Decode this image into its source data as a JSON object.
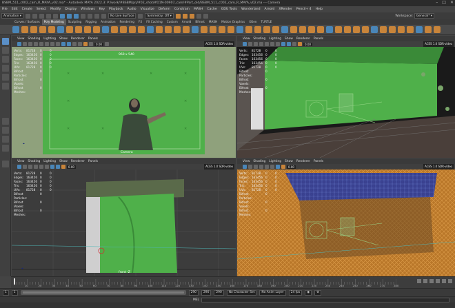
{
  "window": {
    "title": "BSBM_511_c002_cam_R_MAYA_v02.ma* - Autodesk MAYA 2022.3: P:/work/#BSBM/prj/#02_shot/#D1N-00907_cam/#Part_old/BSBM_511_c002_cam_R_MAYA_v02.ma --- Camera",
    "min_icon": "minimize-icon",
    "max_icon": "maximize-icon",
    "close_icon": "close-icon"
  },
  "menus": [
    "File",
    "Edit",
    "Create",
    "Select",
    "Modify",
    "Display",
    "Windows",
    "Key",
    "Playback",
    "Audio",
    "Visualize",
    "Deform",
    "Constrain",
    "MASH",
    "Cache",
    "GDU Tools",
    "Wonderland",
    "Arnold",
    "XRender",
    "Pencil+ 4",
    "Help"
  ],
  "status_line": {
    "mode": "Animation",
    "live_surface": "No Live Surface",
    "symmetry": "Symmetry: Off",
    "workspace_label": "Workspace:",
    "workspace_value": "General*"
  },
  "shelf_tabs": [
    "Curves / Surfaces",
    "Poly Modeling",
    "Sculpting",
    "Rigging",
    "Animation",
    "Rendering",
    "FX",
    "FX Caching",
    "Custom",
    "Arnold",
    "Bifrost",
    "MASH",
    "Motion Graphics",
    "XGen",
    "TURTLE"
  ],
  "active_shelf_tab": "Poly Modeling",
  "panel_menu": [
    "View",
    "Shading",
    "Lighting",
    "Show",
    "Renderer",
    "Panels"
  ],
  "viewports": [
    {
      "id": "top-left",
      "frame_value": "0.00",
      "color_space": "ACES 1.0 SDR-video",
      "top_readout": "960 x 540",
      "camera_label": "Camera",
      "hud": [
        {
          "label": "Verts:",
          "value": "81728",
          "c1": "0",
          "c2": "0"
        },
        {
          "label": "Edges:",
          "value": "163456",
          "c1": "0",
          "c2": "0"
        },
        {
          "label": "Faces:",
          "value": "163456",
          "c1": "0",
          "c2": "0"
        },
        {
          "label": "Tris:",
          "value": "163456",
          "c1": "0",
          "c2": "0"
        },
        {
          "label": "UVs:",
          "value": "81728",
          "c1": "0",
          "c2": "0"
        },
        {
          "label": "Bifrost Particles:",
          "value": "",
          "c1": "0",
          "c2": ""
        },
        {
          "label": "Bifrost Voxels:",
          "value": "",
          "c1": "0",
          "c2": ""
        },
        {
          "label": "Bifrost Meshes:",
          "value": "",
          "c1": "0",
          "c2": ""
        }
      ]
    },
    {
      "id": "top-right",
      "frame_value": "0.00",
      "color_space": "ACES 1.0 SDR-video",
      "hud": [
        {
          "label": "Verts:",
          "value": "81728",
          "c1": "0",
          "c2": "0"
        },
        {
          "label": "Edges:",
          "value": "163456",
          "c1": "0",
          "c2": "0"
        },
        {
          "label": "Faces:",
          "value": "163456",
          "c1": "0",
          "c2": "0"
        },
        {
          "label": "Tris:",
          "value": "163456",
          "c1": "0",
          "c2": "0"
        },
        {
          "label": "UVs:",
          "value": "81728",
          "c1": "0",
          "c2": "0"
        },
        {
          "label": "Bifrost Particles:",
          "value": "",
          "c1": "0",
          "c2": ""
        },
        {
          "label": "Bifrost Voxels:",
          "value": "",
          "c1": "0",
          "c2": ""
        },
        {
          "label": "Bifrost Meshes:",
          "value": "",
          "c1": "0",
          "c2": ""
        }
      ]
    },
    {
      "id": "bottom-left",
      "frame_value": "0.00",
      "color_space": "ACES 1.0 SDR-video",
      "camera_label": "front -Z",
      "hud": [
        {
          "label": "Verts:",
          "value": "81728",
          "c1": "0",
          "c2": "0"
        },
        {
          "label": "Edges:",
          "value": "163456",
          "c1": "0",
          "c2": "0"
        },
        {
          "label": "Faces:",
          "value": "163456",
          "c1": "0",
          "c2": "0"
        },
        {
          "label": "Tris:",
          "value": "163456",
          "c1": "0",
          "c2": "0"
        },
        {
          "label": "UVs:",
          "value": "81728",
          "c1": "0",
          "c2": "0"
        },
        {
          "label": "Bifrost Particles:",
          "value": "",
          "c1": "0",
          "c2": ""
        },
        {
          "label": "Bifrost Voxels:",
          "value": "",
          "c1": "0",
          "c2": ""
        },
        {
          "label": "Bifrost Meshes:",
          "value": "",
          "c1": "0",
          "c2": ""
        }
      ]
    },
    {
      "id": "bottom-right",
      "frame_value": "0.00",
      "color_space": "ACES 1.0 SDR-video",
      "hud": [
        {
          "label": "Verts:",
          "value": "81728",
          "c1": "0",
          "c2": "0"
        },
        {
          "label": "Edges:",
          "value": "163456",
          "c1": "0",
          "c2": "0"
        },
        {
          "label": "Faces:",
          "value": "163456",
          "c1": "0",
          "c2": "0"
        },
        {
          "label": "Tris:",
          "value": "163456",
          "c1": "0",
          "c2": "0"
        },
        {
          "label": "UVs:",
          "value": "81728",
          "c1": "0",
          "c2": "0"
        },
        {
          "label": "Bifrost Particles:",
          "value": "",
          "c1": "0",
          "c2": ""
        },
        {
          "label": "Bifrost Voxels:",
          "value": "",
          "c1": "0",
          "c2": ""
        },
        {
          "label": "Bifrost Meshes:",
          "value": "",
          "c1": "0",
          "c2": ""
        }
      ]
    }
  ],
  "timeline": {
    "ticks": [
      "10",
      "20",
      "30",
      "40",
      "50",
      "60",
      "70",
      "80",
      "90",
      "100",
      "110",
      "120",
      "130",
      "140",
      "150",
      "160",
      "170",
      "180",
      "190",
      "200",
      "210",
      "220",
      "230",
      "240",
      "250",
      "260",
      "270",
      "280"
    ],
    "current_frame": "1"
  },
  "range": {
    "start": "1",
    "inner_start": "1",
    "inner_end": "290",
    "end": "290",
    "end2": "290",
    "character_set": "No Character Set",
    "anim_layer": "No Anim Layer",
    "fps": "24 fps"
  },
  "command_line": {
    "label": "MEL"
  },
  "colors": {
    "green_screen": "#4fb04a",
    "point_cloud_orange": "#d7892d",
    "point_cloud_blue": "#2a3a9a",
    "maya_blue": "#1fb9c9"
  }
}
